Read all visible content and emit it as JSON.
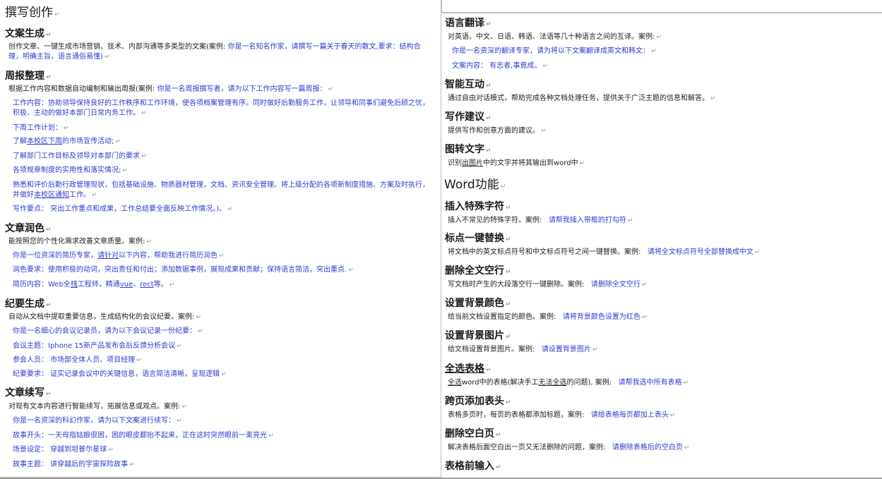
{
  "left": {
    "title": "撰写创作",
    "sec1_title": "文案生成",
    "sec1_desc": "创作文章、一键生成市场营销、技术、内部沟通等多类型的文案(案例:",
    "sec1_example": "你是一名知名作家，请撰写一篇关于春天的散文,要求：结构合理，明确主旨，语言通俗易懂)",
    "sec2_title": "周报整理",
    "sec2_desc": "根据工作内容和数据自动编制和输出周报(案例:",
    "sec2_example": "你是一名周报撰写者，请为以下工作内容写一篇周报：",
    "sec2_work": "工作内容：协助领导保持良好的工作秩序和工作环境，使各项档案管理有序。同时做好后勤服务工作，让领导和同事们避免后顾之忧，积极、主动的做好本部门日常内务工作。",
    "sec2_plan": "下周工作计划：",
    "sec2_item1_a": "了解",
    "sec2_item1_b": "本校区下周",
    "sec2_item1_c": "的市场宣传活动;",
    "sec2_item2": "了解部门工作目标及领导对本部门的要求",
    "sec2_item3": "各项规章制度的实用性和落实情况;",
    "sec2_item4_a": "熟悉和评价后勤行政管理现状，包括基础设施、物质器材管理，文档、资讯安全管理。将上级分配的各项新制度措施、方案及时执行，并做好",
    "sec2_item4_b": "本校区通知",
    "sec2_item4_c": "工作。",
    "sec2_points": "写作要点：  突出工作重点和成果，工作总结要全面反映工作情况。)。",
    "sec3_title": "文章润色",
    "sec3_desc": "能按照您的个性化需求改善文章质量。案例:",
    "sec3_ex1_a": "你是一位资深的简历专家，",
    "sec3_ex1_b": "请针对",
    "sec3_ex1_c": "以下内容，帮助我进行简历润色",
    "sec3_ex2": "润色要求：使用积极的动词，突出责任和付出；添加数据事例，展现成果和贡献；保持语言简洁，突出重点.",
    "sec3_ex3_a": "简历内容：Web全",
    "sec3_ex3_b": "栈",
    "sec3_ex3_c": "工程师，精通",
    "sec3_ex3_d": "vue",
    "sec3_ex3_e": "、",
    "sec3_ex3_f": "rect",
    "sec3_ex3_g": "等。",
    "sec4_title": "纪要生成",
    "sec4_desc": "自动从文档中提取重要信息，生成结构化的会议纪要。案例:",
    "sec4_ex1": "你是一名细心的会议记录员，请为以下会议记录一份纪要：",
    "sec4_ex2": "会议主题：Iphone 15新产品发布会后反馈分析会议",
    "sec4_ex3": "参会人员：  市场部全体人员、项目经理",
    "sec4_ex4": "纪要要求：  证实记录会议中的关键信息，语言简洁清晰，呈现逻辑",
    "sec5_title": "文章续写",
    "sec5_desc": "对现有文本内容进行智能续写，拓展信息或观点。案例:",
    "sec5_ex1": "你是一名资深的科幻作家，请为以下文案进行续写：",
    "sec5_ex2": "故事开头：一天母指姑娘很困，困的眼皮都抬不起来，正在这时突然眼前一束亮光",
    "sec5_ex3": "场景设定：  穿越到坦普尔星球",
    "sec5_ex4": "故事主题：  讲穿越后的宇宙探险故事"
  },
  "right": {
    "r1_title": "语言翻译",
    "r1_desc": "对英语、中文、日语、韩语、法语等几十种语言之间的互译。案例:",
    "r1_ex1": "你是一名资深的翻译专家，请为将以下文案翻译成英文和韩文：",
    "r1_ex2": "文案内容：  有志者,事竟成。",
    "r2_title": "智能互动",
    "r2_desc": "通过自由对话模式，帮助完成各种文档处理任务，提供关于广泛主题的信息和解答。",
    "r3_title": "写作建议",
    "r3_desc": "提供写作和创意方面的建议。",
    "r4_title": "图转文字",
    "r4_desc_a": "识别",
    "r4_desc_b": "出图片",
    "r4_desc_c": "中的文字并将其输出到word中",
    "word_title": "Word功能",
    "w1_title": "插入特殊字符",
    "w1_desc": "插入不常见的特殊字符。案例:",
    "w1_ex": "请帮我插入带框的打勾符",
    "w2_title": "标点一键替换",
    "w2_desc": "将文档中的英文标点符号和中文标点符号之间一键替换。案例:",
    "w2_ex": "请将全文标点符号全部替换成中文",
    "w3_title": "删除全文空行",
    "w3_desc": "写文档时产生的大段落空行一键删除。案例:",
    "w3_ex": "请删除全文空行",
    "w4_title": "设置背景颜色",
    "w4_desc": "给当前文档设置指定的颜色。案例:",
    "w4_ex": "请将背景颜色设置为红色",
    "w5_title": "设置背景图片",
    "w5_desc": "给文档设置背景图片。案例:",
    "w5_ex": "请设置背景图片",
    "w6_title": "全选表格",
    "w6_desc_a": "全选",
    "w6_desc_b": "word中的表格(解决手工",
    "w6_desc_c": "无法全选",
    "w6_desc_d": "的问题), 案例:",
    "w6_ex": "请帮我选中所有表格",
    "w7_title": "跨页添加表头",
    "w7_desc": "表格多页时，每页的表格都添加标题，案例:",
    "w7_ex": "请给表格每页都加上表头",
    "w8_title": "删除空白页",
    "w8_desc": "解决表格后面空白出一页又无法删除的问题，案例:",
    "w8_ex": "请删除表格后的空白页",
    "w9_title": "表格前输入"
  },
  "marks": {
    "para": "↵"
  }
}
